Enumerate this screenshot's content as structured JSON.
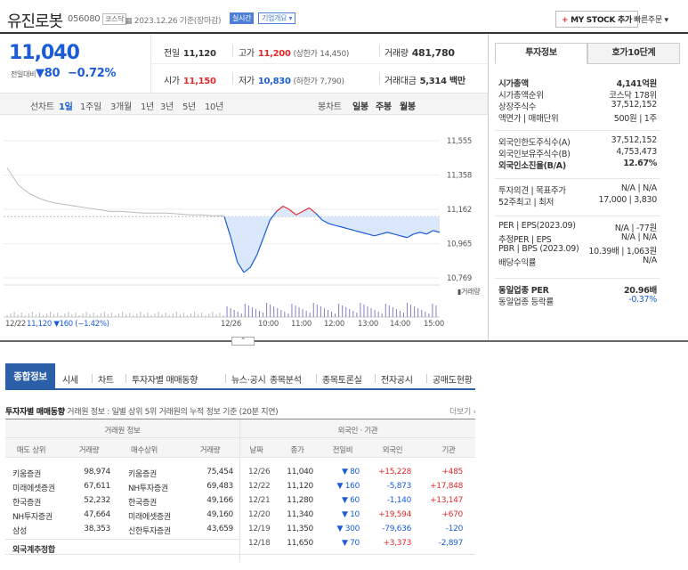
{
  "header": {
    "name": "유진로봇",
    "code": "056080",
    "market": "코스닥",
    "date": "2023.12.26 기준(장마감)",
    "realtime": "실시간",
    "company": "기업개요",
    "mystock": "MY STOCK 추가",
    "quick": "빠른주문"
  },
  "quote": {
    "price": "11,040",
    "change_label": "전일대비",
    "change": "▼80",
    "change_pct": "−0.72%",
    "prev_label": "전일",
    "prev": "11,120",
    "high_label": "고가",
    "high": "11,200",
    "upper": "(상한가 14,450)",
    "vol_label": "거래량",
    "vol": "481,780",
    "open_label": "시가",
    "open": "11,150",
    "low_label": "저가",
    "low": "10,830",
    "lower": "(하한가 7,790)",
    "amt_label": "거래대금",
    "amt": "5,314 백만"
  },
  "chart_tabs": {
    "line": "선차트",
    "items": [
      "1일",
      "1주일",
      "3개월",
      "1년",
      "3년",
      "5년",
      "10년"
    ],
    "candle": "봉차트",
    "citems": [
      "일봉",
      "주봉",
      "월봉"
    ]
  },
  "chart_data": {
    "type": "line",
    "yticks": [
      11555,
      11358,
      11162,
      10965,
      10769
    ],
    "ylim": [
      10769,
      11555
    ],
    "prev_day_label": "12/22",
    "prev_day_close": "11,120",
    "prev_day_change": "▼160 (−1.42%)",
    "xticks": [
      "12/26",
      "10:00",
      "11:00",
      "12:00",
      "13:00",
      "14:00",
      "15:00"
    ],
    "vol_label": "거래량",
    "series": [
      {
        "values": [
          11400,
          11300,
          11250,
          11220,
          11200,
          11190,
          11180,
          11170,
          11160,
          11150,
          11150,
          11145,
          11140,
          11140,
          11140,
          11135,
          11130,
          11130,
          11125,
          11125
        ]
      },
      {
        "values": [
          11120,
          11000,
          10860,
          10800,
          10830,
          10900,
          11000,
          11100,
          11150,
          11180,
          11160,
          11130,
          11150,
          11170,
          11140,
          11100,
          11080,
          11070,
          11060,
          11050,
          11040,
          11030,
          11020,
          11010,
          11020,
          11030,
          11020,
          11010,
          11000,
          11020,
          11030,
          11020,
          11040,
          11030
        ]
      }
    ]
  },
  "right": {
    "tab1": "투자정보",
    "tab2": "호가10단계",
    "rows1": [
      [
        "시가총액",
        "4,141억원"
      ],
      [
        "시가총액순위",
        "코스닥 178위"
      ],
      [
        "상장주식수",
        "37,512,152"
      ],
      [
        "액면가 | 매매단위",
        "500원 | 1주"
      ]
    ],
    "rows2": [
      [
        "외국인한도주식수(A)",
        "37,512,152"
      ],
      [
        "외국인보유주식수(B)",
        "4,753,473"
      ],
      [
        "외국인소진율(B/A)",
        "12.67%"
      ]
    ],
    "rows3": [
      [
        "투자의견 | 목표주가",
        "N/A | N/A"
      ],
      [
        "52주최고 | 최저",
        "17,000 | 3,830"
      ]
    ],
    "rows4": [
      [
        "PER | EPS(2023.09)",
        "N/A | -77원"
      ],
      [
        "추정PER | EPS",
        "N/A | N/A"
      ],
      [
        "PBR | BPS (2023.09)",
        "10.39배 | 1,063원"
      ],
      [
        "배당수익률",
        "N/A"
      ]
    ],
    "rows5": [
      [
        "동일업종 PER",
        "20.96배"
      ],
      [
        "동일업종 등락률",
        "-0.37%"
      ]
    ]
  },
  "tabs2": [
    "종합정보",
    "시세",
    "차트",
    "투자자별 매매동향",
    "뉴스·공시",
    "종목분석",
    "종목토론실",
    "전자공시",
    "공매도현황"
  ],
  "section": {
    "title": "투자자별 매매동향",
    "desc": "거래원 정보 : 일별 상위 5위 거래원의 누적 정보 기준 (20분 지연)",
    "more": "더보기"
  },
  "table": {
    "g1": "거래원 정보",
    "g2": "외국인 · 기관",
    "h": [
      "매도 상위",
      "거래량",
      "매수상위",
      "거래량",
      "날짜",
      "종가",
      "전일비",
      "외국인",
      "기관"
    ],
    "left": [
      [
        "키움증권",
        "98,974",
        "키움증권",
        "75,454"
      ],
      [
        "미래에셋증권",
        "67,611",
        "NH투자증권",
        "69,483"
      ],
      [
        "한국증권",
        "52,232",
        "한국증권",
        "49,166"
      ],
      [
        "NH투자증권",
        "47,664",
        "미래에셋증권",
        "49,160"
      ],
      [
        "삼성",
        "38,353",
        "신한투자증권",
        "43,659"
      ]
    ],
    "foreign_sum": "외국계추정합",
    "right": [
      [
        "12/26",
        "11,040",
        "▼ 80",
        "+15,228",
        "+485"
      ],
      [
        "12/22",
        "11,120",
        "▼ 160",
        "-5,873",
        "+17,848"
      ],
      [
        "12/21",
        "11,280",
        "▼ 60",
        "-1,140",
        "+13,147"
      ],
      [
        "12/20",
        "11,340",
        "▼ 10",
        "+19,594",
        "+670"
      ],
      [
        "12/19",
        "11,350",
        "▼ 300",
        "-79,636",
        "-120"
      ],
      [
        "12/18",
        "11,650",
        "▼ 70",
        "+3,373",
        "-2,897"
      ]
    ]
  }
}
